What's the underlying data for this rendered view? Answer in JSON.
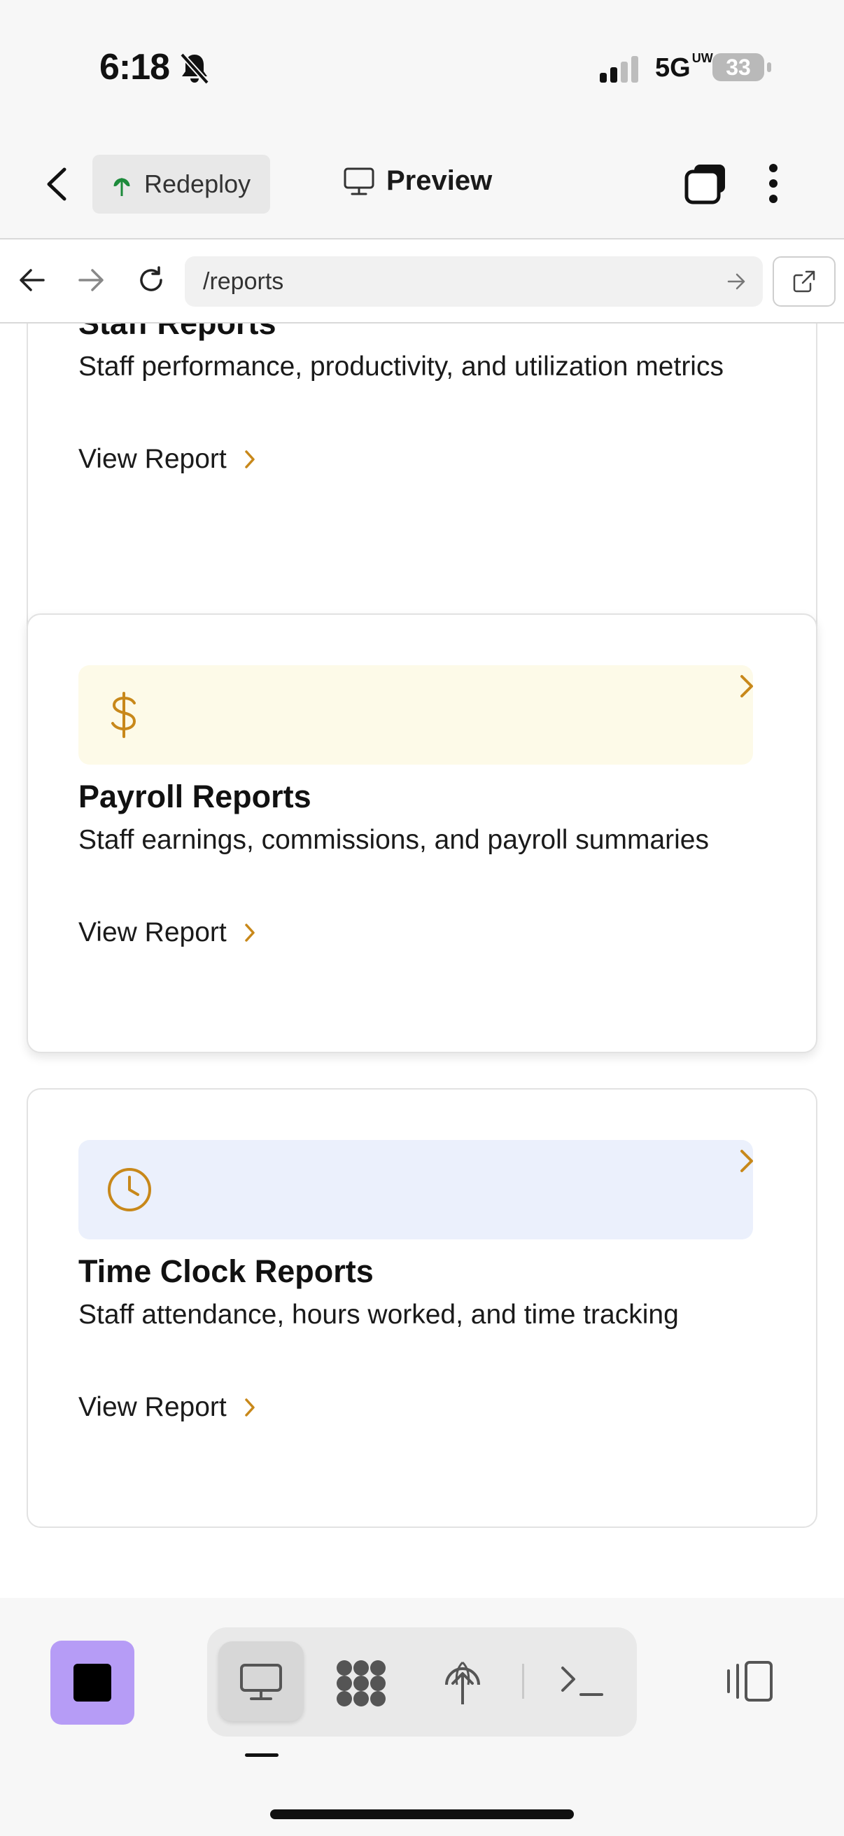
{
  "status_bar": {
    "time": "6:18",
    "network": "5G",
    "network_badge": "UW",
    "battery": "33",
    "icons": [
      "bell-slash-icon",
      "signal-icon"
    ]
  },
  "header": {
    "back_icon": "chevron-left-icon",
    "redeploy_label": "Redeploy",
    "redeploy_icon": "deploy-tree-icon",
    "preview_label": "Preview",
    "preview_icon": "monitor-icon",
    "tabs_icon": "tabs-stack-icon",
    "menu_icon": "more-vertical-icon"
  },
  "browser": {
    "url": "/reports",
    "icons": [
      "arrow-left-icon",
      "arrow-right-icon",
      "reload-icon",
      "go-arrow-icon",
      "external-link-icon"
    ]
  },
  "cards": [
    {
      "title": "Staff Reports",
      "description": "Staff performance, productivity, and utilization metrics",
      "link": "View Report"
    },
    {
      "title": "Payroll Reports",
      "description": "Staff earnings, commissions, and payroll summaries",
      "link": "View Report",
      "icon": "dollar-icon",
      "banner_color": "#fdfae8"
    },
    {
      "title": "Time Clock Reports",
      "description": "Staff attendance, hours worked, and time tracking",
      "link": "View Report",
      "icon": "clock-icon",
      "banner_color": "#ebf0fc"
    }
  ],
  "accent_color": "#c8881a",
  "toolbar": {
    "stop_color": "#b69cf6",
    "items": [
      "monitor-icon",
      "cluster-icon",
      "deploy-icon",
      "terminal-icon",
      "split-view-icon"
    ]
  }
}
